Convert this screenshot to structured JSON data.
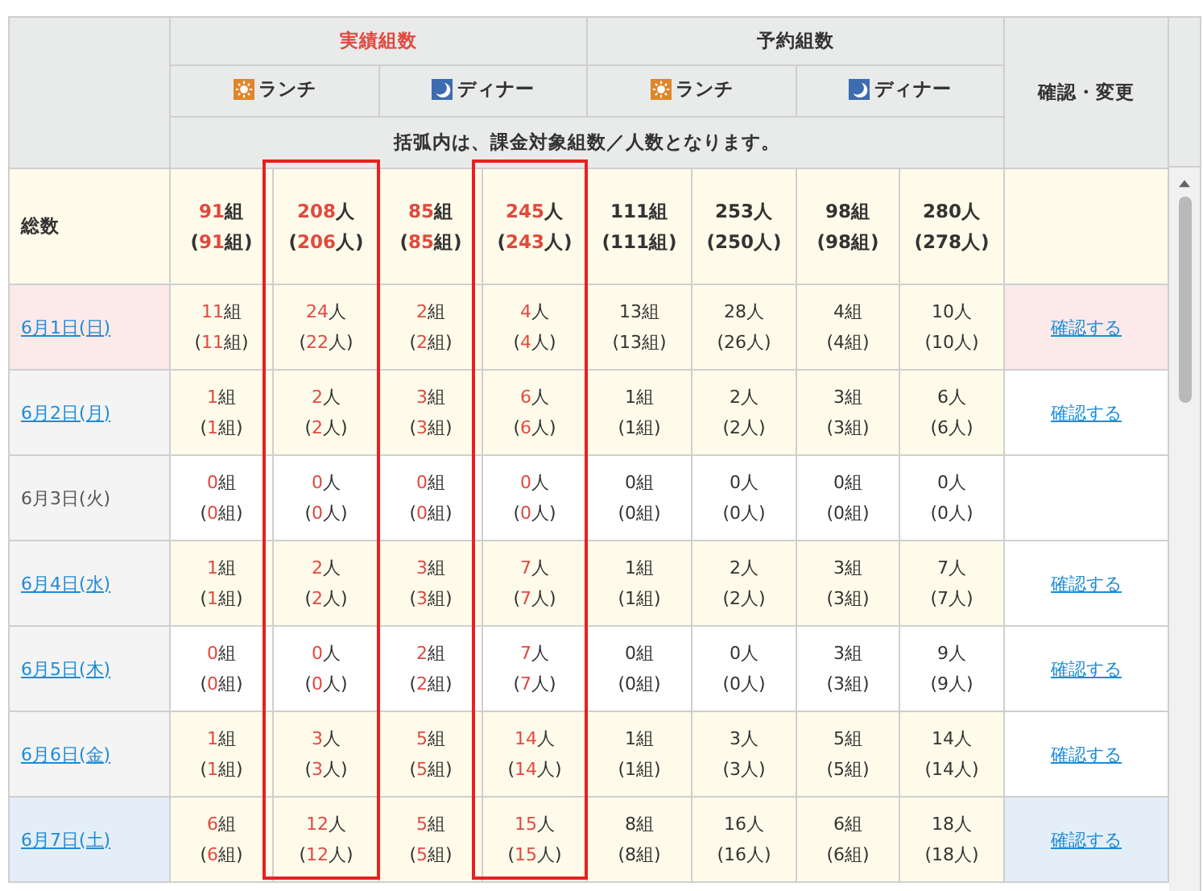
{
  "header": {
    "actual_title": "実績組数",
    "reserved_title": "予約組数",
    "action_title": "確認・変更",
    "note": "括弧内は、課金対象組数／人数となります。",
    "meals": [
      {
        "kind": "lunch",
        "label": "ランチ"
      },
      {
        "kind": "dinner",
        "label": "ディナー"
      },
      {
        "kind": "lunch",
        "label": "ランチ"
      },
      {
        "kind": "dinner",
        "label": "ディナー"
      }
    ]
  },
  "columns": [
    {
      "kind": "actual",
      "framed": false
    },
    {
      "kind": "actual",
      "framed": true
    },
    {
      "kind": "actual",
      "framed": false
    },
    {
      "kind": "actual",
      "framed": true
    },
    {
      "kind": "reserved",
      "framed": false
    },
    {
      "kind": "reserved",
      "framed": false
    },
    {
      "kind": "reserved",
      "framed": false
    },
    {
      "kind": "reserved",
      "framed": false
    }
  ],
  "total": {
    "label": "総数",
    "cells": [
      [
        "91組",
        "(91組)"
      ],
      [
        "208人",
        "(206人)"
      ],
      [
        "85組",
        "(85組)"
      ],
      [
        "245人",
        "(243人)"
      ],
      [
        "111組",
        "(111組)"
      ],
      [
        "253人",
        "(250人)"
      ],
      [
        "98組",
        "(98組)"
      ],
      [
        "280人",
        "(278人)"
      ]
    ]
  },
  "rows": [
    {
      "date": "6月1日(日)",
      "kind": "sunday",
      "link": true,
      "highlighted": true,
      "action": "確認する",
      "cells": [
        [
          "11組",
          "(11組)"
        ],
        [
          "24人",
          "(22人)"
        ],
        [
          "2組",
          "(2組)"
        ],
        [
          "4人",
          "(4人)"
        ],
        [
          "13組",
          "(13組)"
        ],
        [
          "28人",
          "(26人)"
        ],
        [
          "4組",
          "(4組)"
        ],
        [
          "10人",
          "(10人)"
        ]
      ]
    },
    {
      "date": "6月2日(月)",
      "kind": "weekday",
      "link": true,
      "highlighted": true,
      "action": "確認する",
      "cells": [
        [
          "1組",
          "(1組)"
        ],
        [
          "2人",
          "(2人)"
        ],
        [
          "3組",
          "(3組)"
        ],
        [
          "6人",
          "(6人)"
        ],
        [
          "1組",
          "(1組)"
        ],
        [
          "2人",
          "(2人)"
        ],
        [
          "3組",
          "(3組)"
        ],
        [
          "6人",
          "(6人)"
        ]
      ]
    },
    {
      "date": "6月3日(火)",
      "kind": "weekday",
      "link": false,
      "highlighted": false,
      "cells": [
        [
          "0組",
          "(0組)"
        ],
        [
          "0人",
          "(0人)"
        ],
        [
          "0組",
          "(0組)"
        ],
        [
          "0人",
          "(0人)"
        ],
        [
          "0組",
          "(0組)"
        ],
        [
          "0人",
          "(0人)"
        ],
        [
          "0組",
          "(0組)"
        ],
        [
          "0人",
          "(0人)"
        ]
      ]
    },
    {
      "date": "6月4日(水)",
      "kind": "weekday",
      "link": true,
      "highlighted": true,
      "action": "確認する",
      "cells": [
        [
          "1組",
          "(1組)"
        ],
        [
          "2人",
          "(2人)"
        ],
        [
          "3組",
          "(3組)"
        ],
        [
          "7人",
          "(7人)"
        ],
        [
          "1組",
          "(1組)"
        ],
        [
          "2人",
          "(2人)"
        ],
        [
          "3組",
          "(3組)"
        ],
        [
          "7人",
          "(7人)"
        ]
      ]
    },
    {
      "date": "6月5日(木)",
      "kind": "weekday",
      "link": true,
      "highlighted": false,
      "action": "確認する",
      "cells": [
        [
          "0組",
          "(0組)"
        ],
        [
          "0人",
          "(0人)"
        ],
        [
          "2組",
          "(2組)"
        ],
        [
          "7人",
          "(7人)"
        ],
        [
          "0組",
          "(0組)"
        ],
        [
          "0人",
          "(0人)"
        ],
        [
          "3組",
          "(3組)"
        ],
        [
          "9人",
          "(9人)"
        ]
      ]
    },
    {
      "date": "6月6日(金)",
      "kind": "weekday",
      "link": true,
      "highlighted": true,
      "action": "確認する",
      "cells": [
        [
          "1組",
          "(1組)"
        ],
        [
          "3人",
          "(3人)"
        ],
        [
          "5組",
          "(5組)"
        ],
        [
          "14人",
          "(14人)"
        ],
        [
          "1組",
          "(1組)"
        ],
        [
          "3人",
          "(3人)"
        ],
        [
          "5組",
          "(5組)"
        ],
        [
          "14人",
          "(14人)"
        ]
      ]
    },
    {
      "date": "6月7日(土)",
      "kind": "saturday",
      "link": true,
      "highlighted": true,
      "action": "確認する",
      "cells": [
        [
          "6組",
          "(6組)"
        ],
        [
          "12人",
          "(12人)"
        ],
        [
          "5組",
          "(5組)"
        ],
        [
          "15人",
          "(15人)"
        ],
        [
          "8組",
          "(8組)"
        ],
        [
          "16人",
          "(16人)"
        ],
        [
          "6組",
          "(6組)"
        ],
        [
          "18人",
          "(18人)"
        ]
      ]
    }
  ]
}
